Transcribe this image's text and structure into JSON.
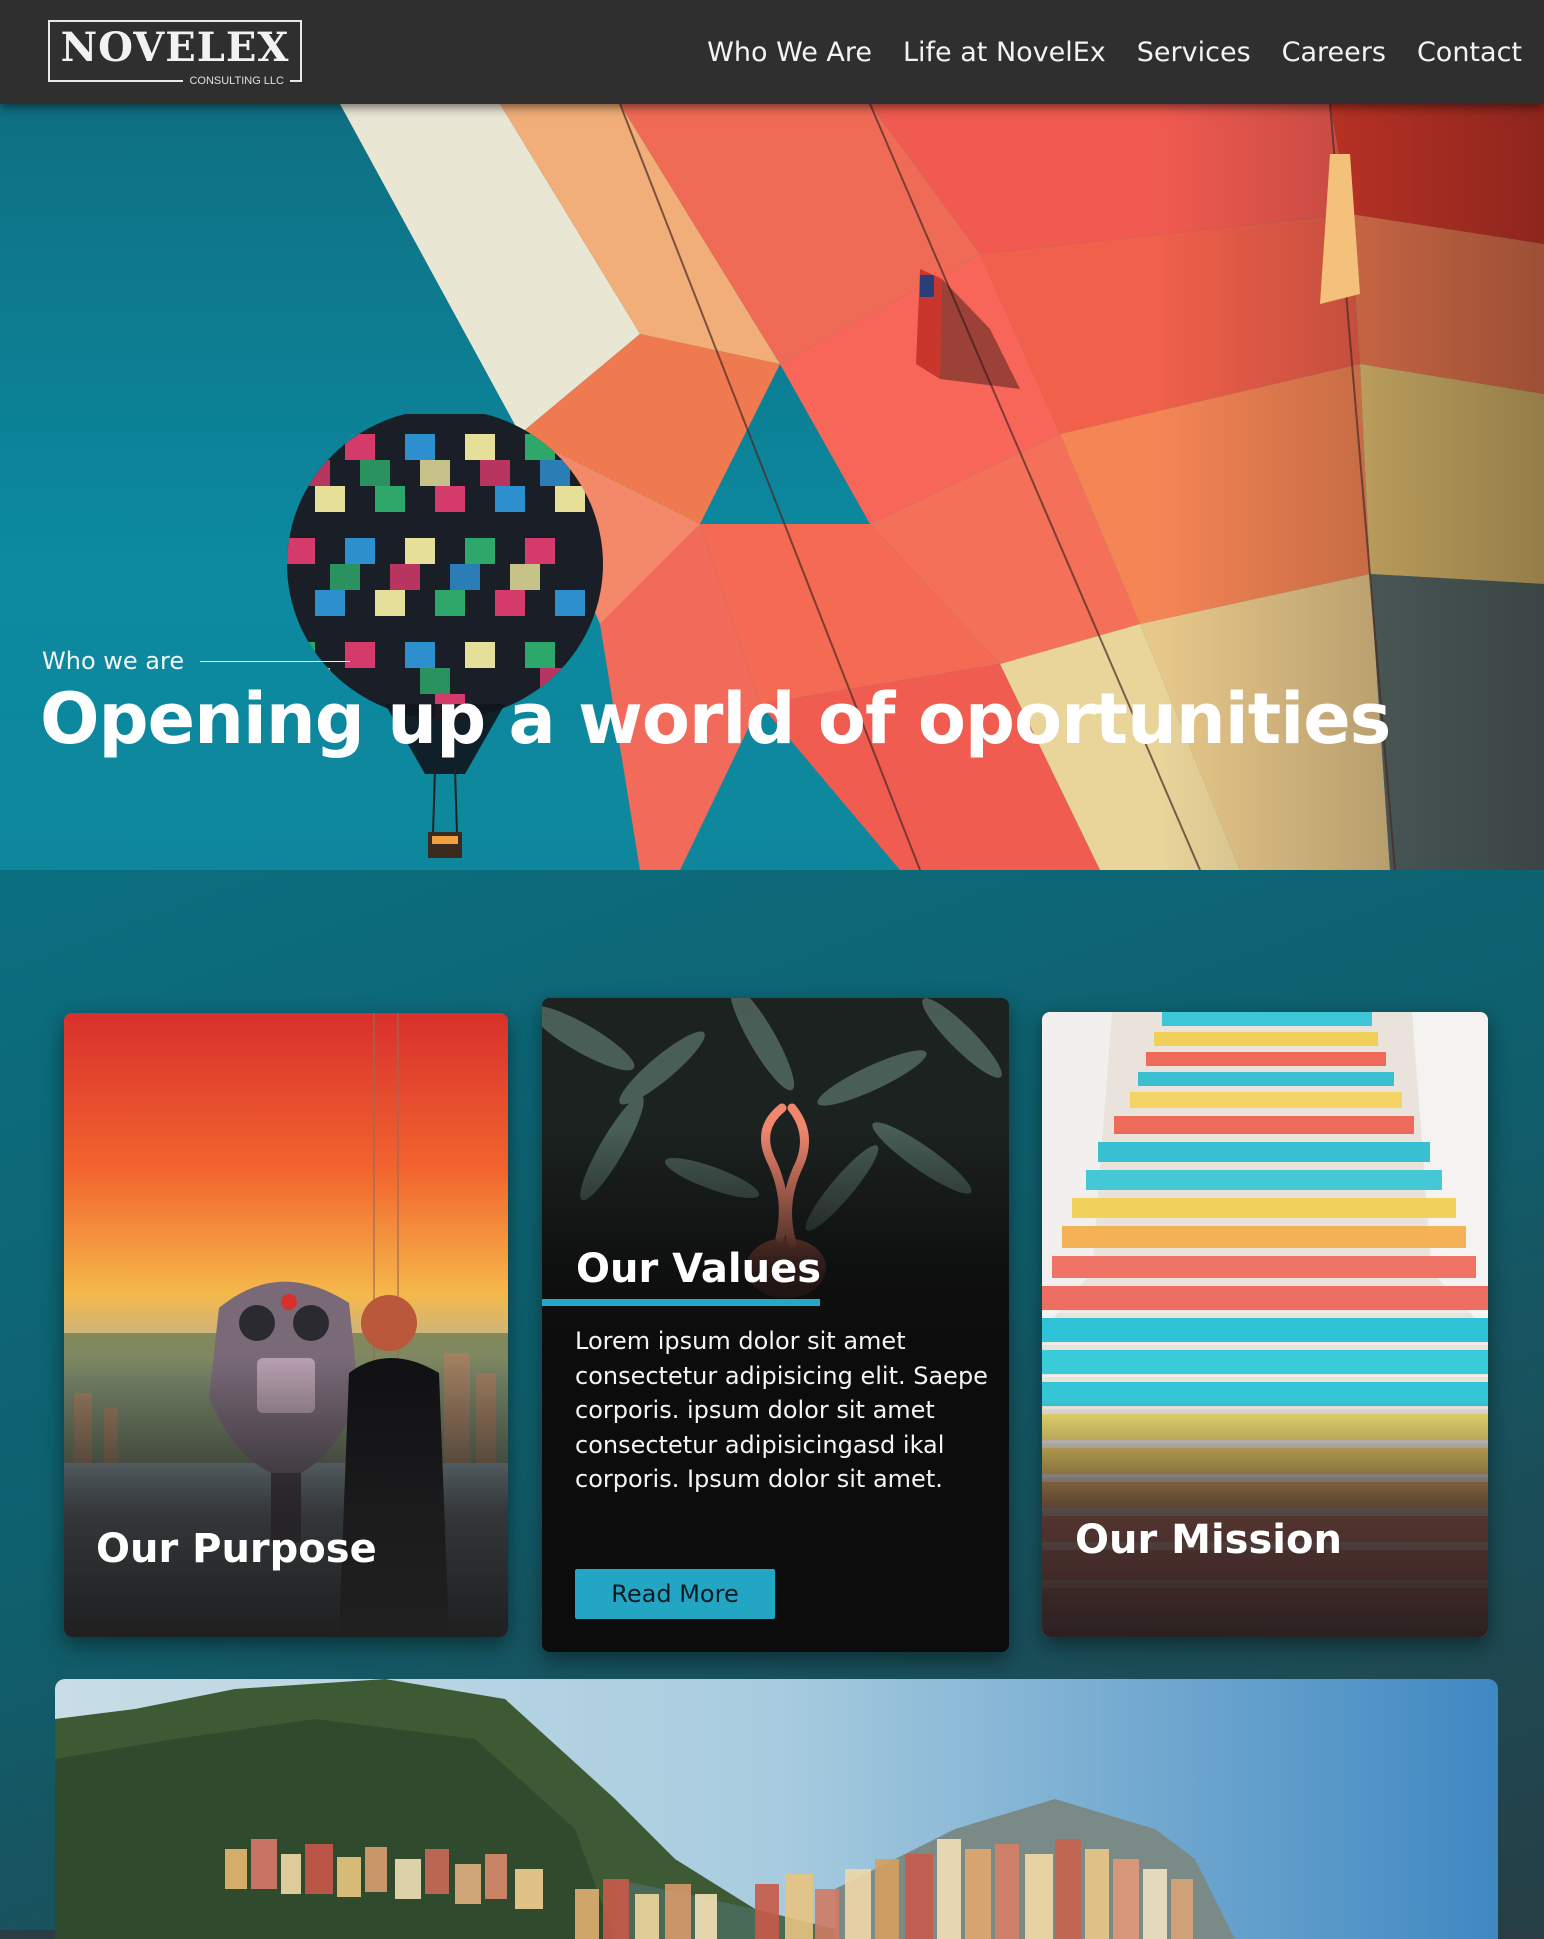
{
  "brand": {
    "name": "NOVELEX",
    "sub": "CONSULTING LLC"
  },
  "nav": {
    "items": [
      {
        "label": "Who We Are"
      },
      {
        "label": "Life at NovelEx"
      },
      {
        "label": "Services"
      },
      {
        "label": "Careers"
      },
      {
        "label": "Contact"
      }
    ]
  },
  "hero": {
    "kicker": "Who we are",
    "title": "Opening up a world of oportunities"
  },
  "cards": {
    "purpose": {
      "title": "Our Purpose"
    },
    "values": {
      "title": "Our Values",
      "body": "Lorem ipsum dolor sit amet consectetur adipisicing elit. Saepe corporis. ipsum dolor sit amet consectetur adipisicingasd ikal corporis. Ipsum dolor sit amet.",
      "button": "Read More"
    },
    "mission": {
      "title": "Our Mission"
    }
  },
  "colors": {
    "header": "#2f2f30",
    "accent": "#22a6c4",
    "hero_sky": "#0b8aa0",
    "section_bg": "#0f5f6d"
  }
}
